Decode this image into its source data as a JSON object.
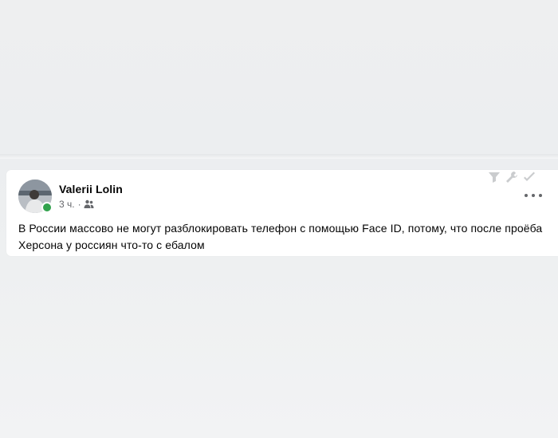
{
  "post": {
    "author": "Valerii Lolin",
    "time": "3 ч.",
    "separator": "·",
    "audience_icon": "friends-icon",
    "text": "В  России массово не могут разблокировать телефон с помощью Face ID, потому, что после проёба Херсона у россиян что-то с ебалом"
  },
  "colors": {
    "online": "#31a24c",
    "meta_text": "#65676b",
    "post_text": "#050505"
  }
}
